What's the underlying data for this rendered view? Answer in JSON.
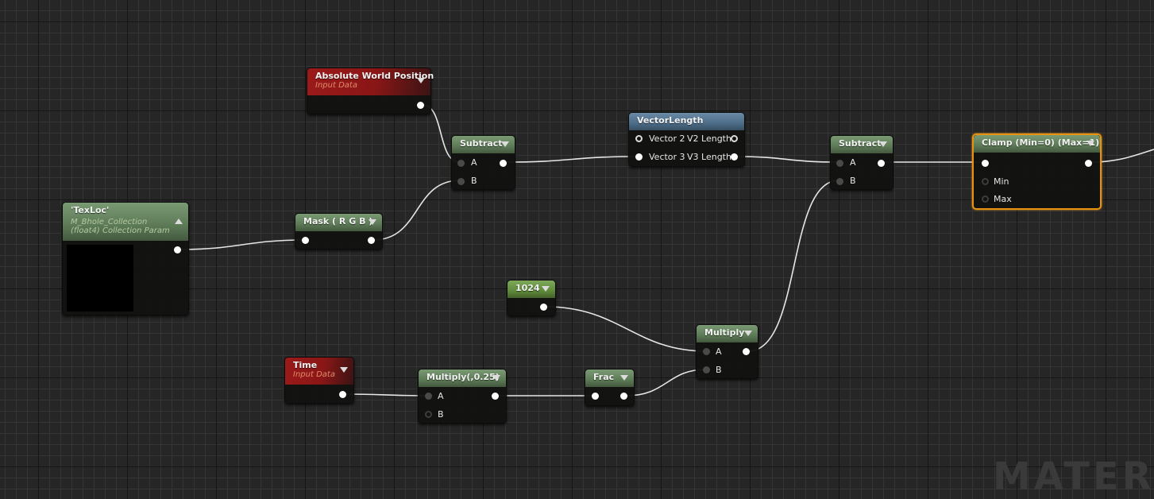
{
  "editor": {
    "watermark": "MATERIAL"
  },
  "nodes": {
    "absolute_world_position": {
      "title": "Absolute World Position",
      "subtitle": "Input Data"
    },
    "subtract_1": {
      "title": "Subtract",
      "pin_a": "A",
      "pin_b": "B"
    },
    "vector_length": {
      "title": "VectorLength",
      "in_v2": "Vector 2",
      "out_v2": "V2 Length",
      "in_v3": "Vector 3",
      "out_v3": "V3 Length"
    },
    "subtract_2": {
      "title": "Subtract",
      "pin_a": "A",
      "pin_b": "B"
    },
    "clamp": {
      "title": "Clamp (Min=0) (Max=1)",
      "pin_min": "Min",
      "pin_max": "Max"
    },
    "texloc": {
      "title": "'TexLoc'",
      "subtitle_1": "M_Bhole_Collection",
      "subtitle_2": "(float4) Collection Param"
    },
    "mask": {
      "title": "Mask ( R G B )"
    },
    "constant_1024": {
      "title": "1024"
    },
    "multiply": {
      "title": "Multiply",
      "pin_a": "A",
      "pin_b": "B"
    },
    "time": {
      "title": "Time",
      "subtitle": "Input Data"
    },
    "multiply_025": {
      "title": "Multiply(,0.25)",
      "pin_a": "A",
      "pin_b": "B"
    },
    "frac": {
      "title": "Frac"
    }
  },
  "colors": {
    "selection": "#e8920f",
    "wire": "#e6e6e6"
  }
}
